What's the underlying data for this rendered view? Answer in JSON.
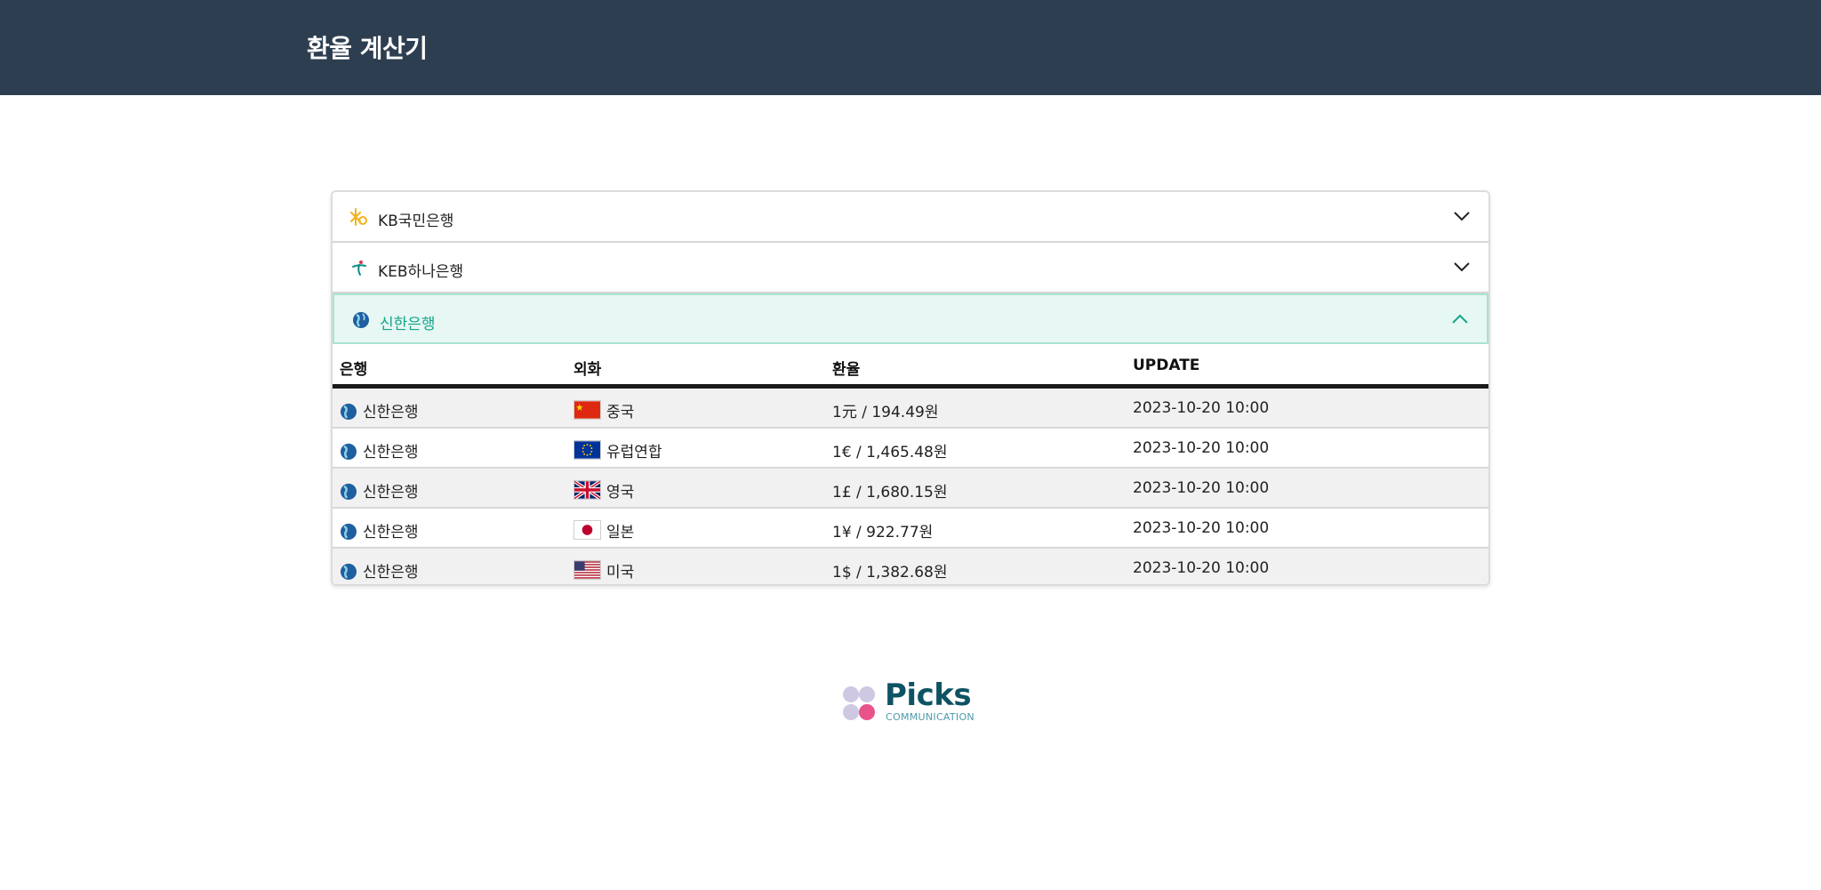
{
  "header": {
    "title": "환율 계산기"
  },
  "banks": [
    {
      "name": "KB국민은행",
      "logo": "kb-star-logo-icon",
      "expanded": false
    },
    {
      "name": "KEB하나은행",
      "logo": "hana-logo-icon",
      "expanded": false
    },
    {
      "name": "신한은행",
      "logo": "shinhan-globe-logo-icon",
      "expanded": true
    }
  ],
  "table": {
    "headers": {
      "bank": "은행",
      "currency": "외화",
      "rate": "환율",
      "update": "UPDATE"
    },
    "rows": [
      {
        "bank": "신한은행",
        "country": "중국",
        "flag": "china-flag-icon",
        "rate": "1元 / 194.49원",
        "update": "2023-10-20 10:00"
      },
      {
        "bank": "신한은행",
        "country": "유럽연합",
        "flag": "eu-flag-icon",
        "rate": "1€ / 1,465.48원",
        "update": "2023-10-20 10:00"
      },
      {
        "bank": "신한은행",
        "country": "영국",
        "flag": "uk-flag-icon",
        "rate": "1£ / 1,680.15원",
        "update": "2023-10-20 10:00"
      },
      {
        "bank": "신한은행",
        "country": "일본",
        "flag": "japan-flag-icon",
        "rate": "1¥ / 922.77원",
        "update": "2023-10-20 10:00"
      },
      {
        "bank": "신한은행",
        "country": "미국",
        "flag": "usa-flag-icon",
        "rate": "1$ / 1,382.68원",
        "update": "2023-10-20 10:00"
      }
    ]
  },
  "footer": {
    "brand": "Picks",
    "sub": "COMMUNICATION"
  },
  "colors": {
    "header_bg": "#2d3e50",
    "accent": "#14a58a",
    "open_bg": "#e7f7f3"
  }
}
